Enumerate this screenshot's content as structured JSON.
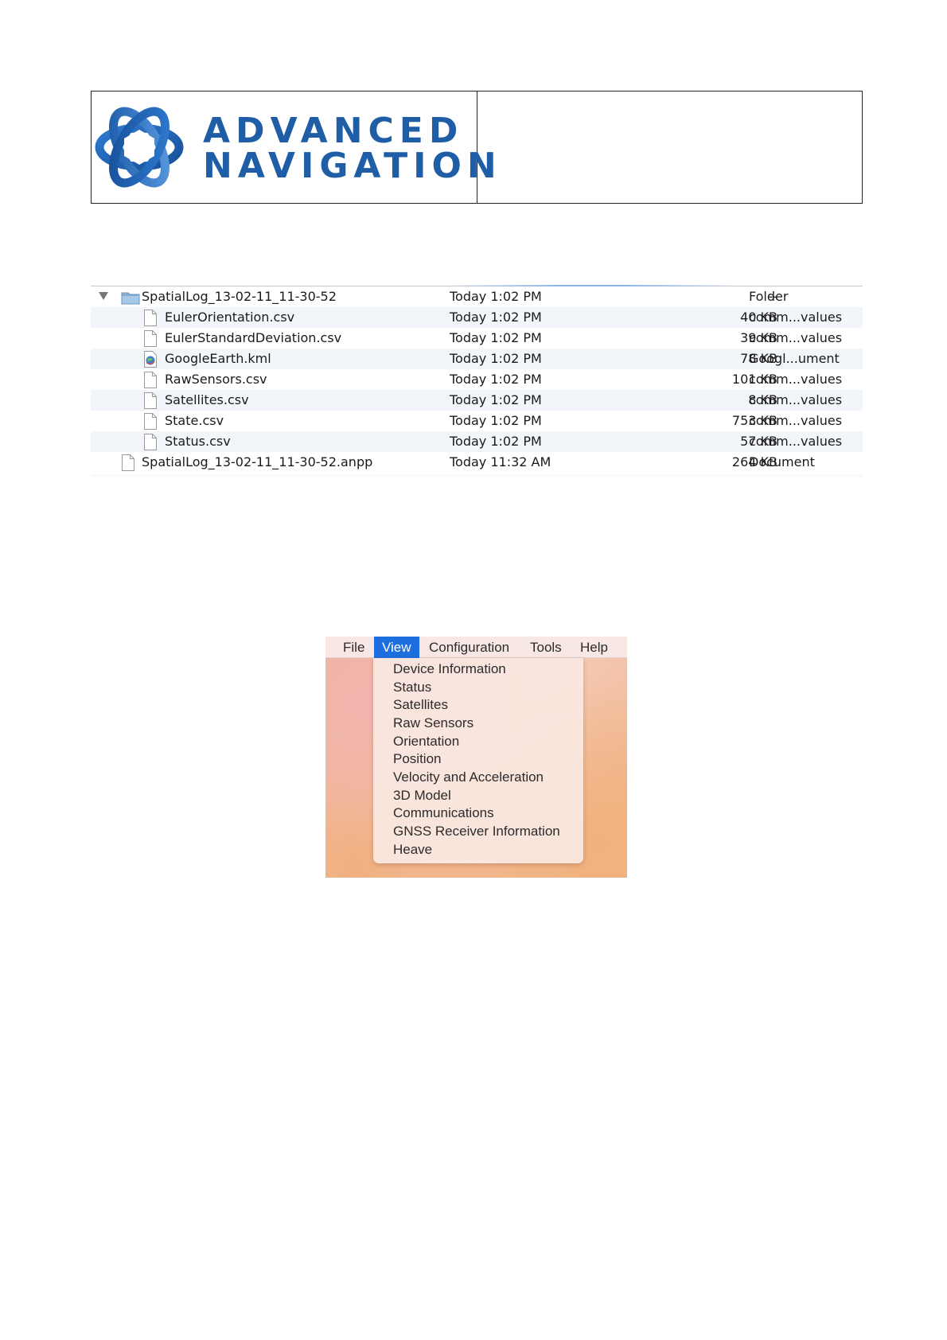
{
  "header": {
    "logo_line1": "ADVANCED",
    "logo_line2": "NAVIGATION",
    "brand_color": "#1f5ea6"
  },
  "file_list": {
    "rows": [
      {
        "name": "SpatialLog_13-02-11_11-30-52",
        "date": "Today 1:02 PM",
        "size": "--",
        "kind": "Folder",
        "icon": "folder-icon"
      },
      {
        "name": "EulerOrientation.csv",
        "date": "Today 1:02 PM",
        "size": "40 KB",
        "kind": "comm...values",
        "icon": "document-icon"
      },
      {
        "name": "EulerStandardDeviation.csv",
        "date": "Today 1:02 PM",
        "size": "39 KB",
        "kind": "comm...values",
        "icon": "document-icon"
      },
      {
        "name": "GoogleEarth.kml",
        "date": "Today 1:02 PM",
        "size": "78 KB",
        "kind": "Googl...ument",
        "icon": "google-earth-icon"
      },
      {
        "name": "RawSensors.csv",
        "date": "Today 1:02 PM",
        "size": "101 KB",
        "kind": "comm...values",
        "icon": "document-icon"
      },
      {
        "name": "Satellites.csv",
        "date": "Today 1:02 PM",
        "size": "8 KB",
        "kind": "comm...values",
        "icon": "document-icon"
      },
      {
        "name": "State.csv",
        "date": "Today 1:02 PM",
        "size": "753 KB",
        "kind": "comm...values",
        "icon": "document-icon"
      },
      {
        "name": "Status.csv",
        "date": "Today 1:02 PM",
        "size": "57 KB",
        "kind": "comm...values",
        "icon": "document-icon"
      },
      {
        "name": "SpatialLog_13-02-11_11-30-52.anpp",
        "date": "Today 11:32 AM",
        "size": "264 KB",
        "kind": "Document",
        "icon": "document-icon"
      }
    ]
  },
  "menu": {
    "menubar": [
      "File",
      "View",
      "Configuration",
      "Tools",
      "Help"
    ],
    "active": "View",
    "active_color": "#1d6fe0",
    "items": [
      "Device Information",
      "Status",
      "Satellites",
      "Raw Sensors",
      "Orientation",
      "Position",
      "Velocity and Acceleration",
      "3D Model",
      "Communications",
      "GNSS Receiver Information",
      "Heave"
    ]
  }
}
